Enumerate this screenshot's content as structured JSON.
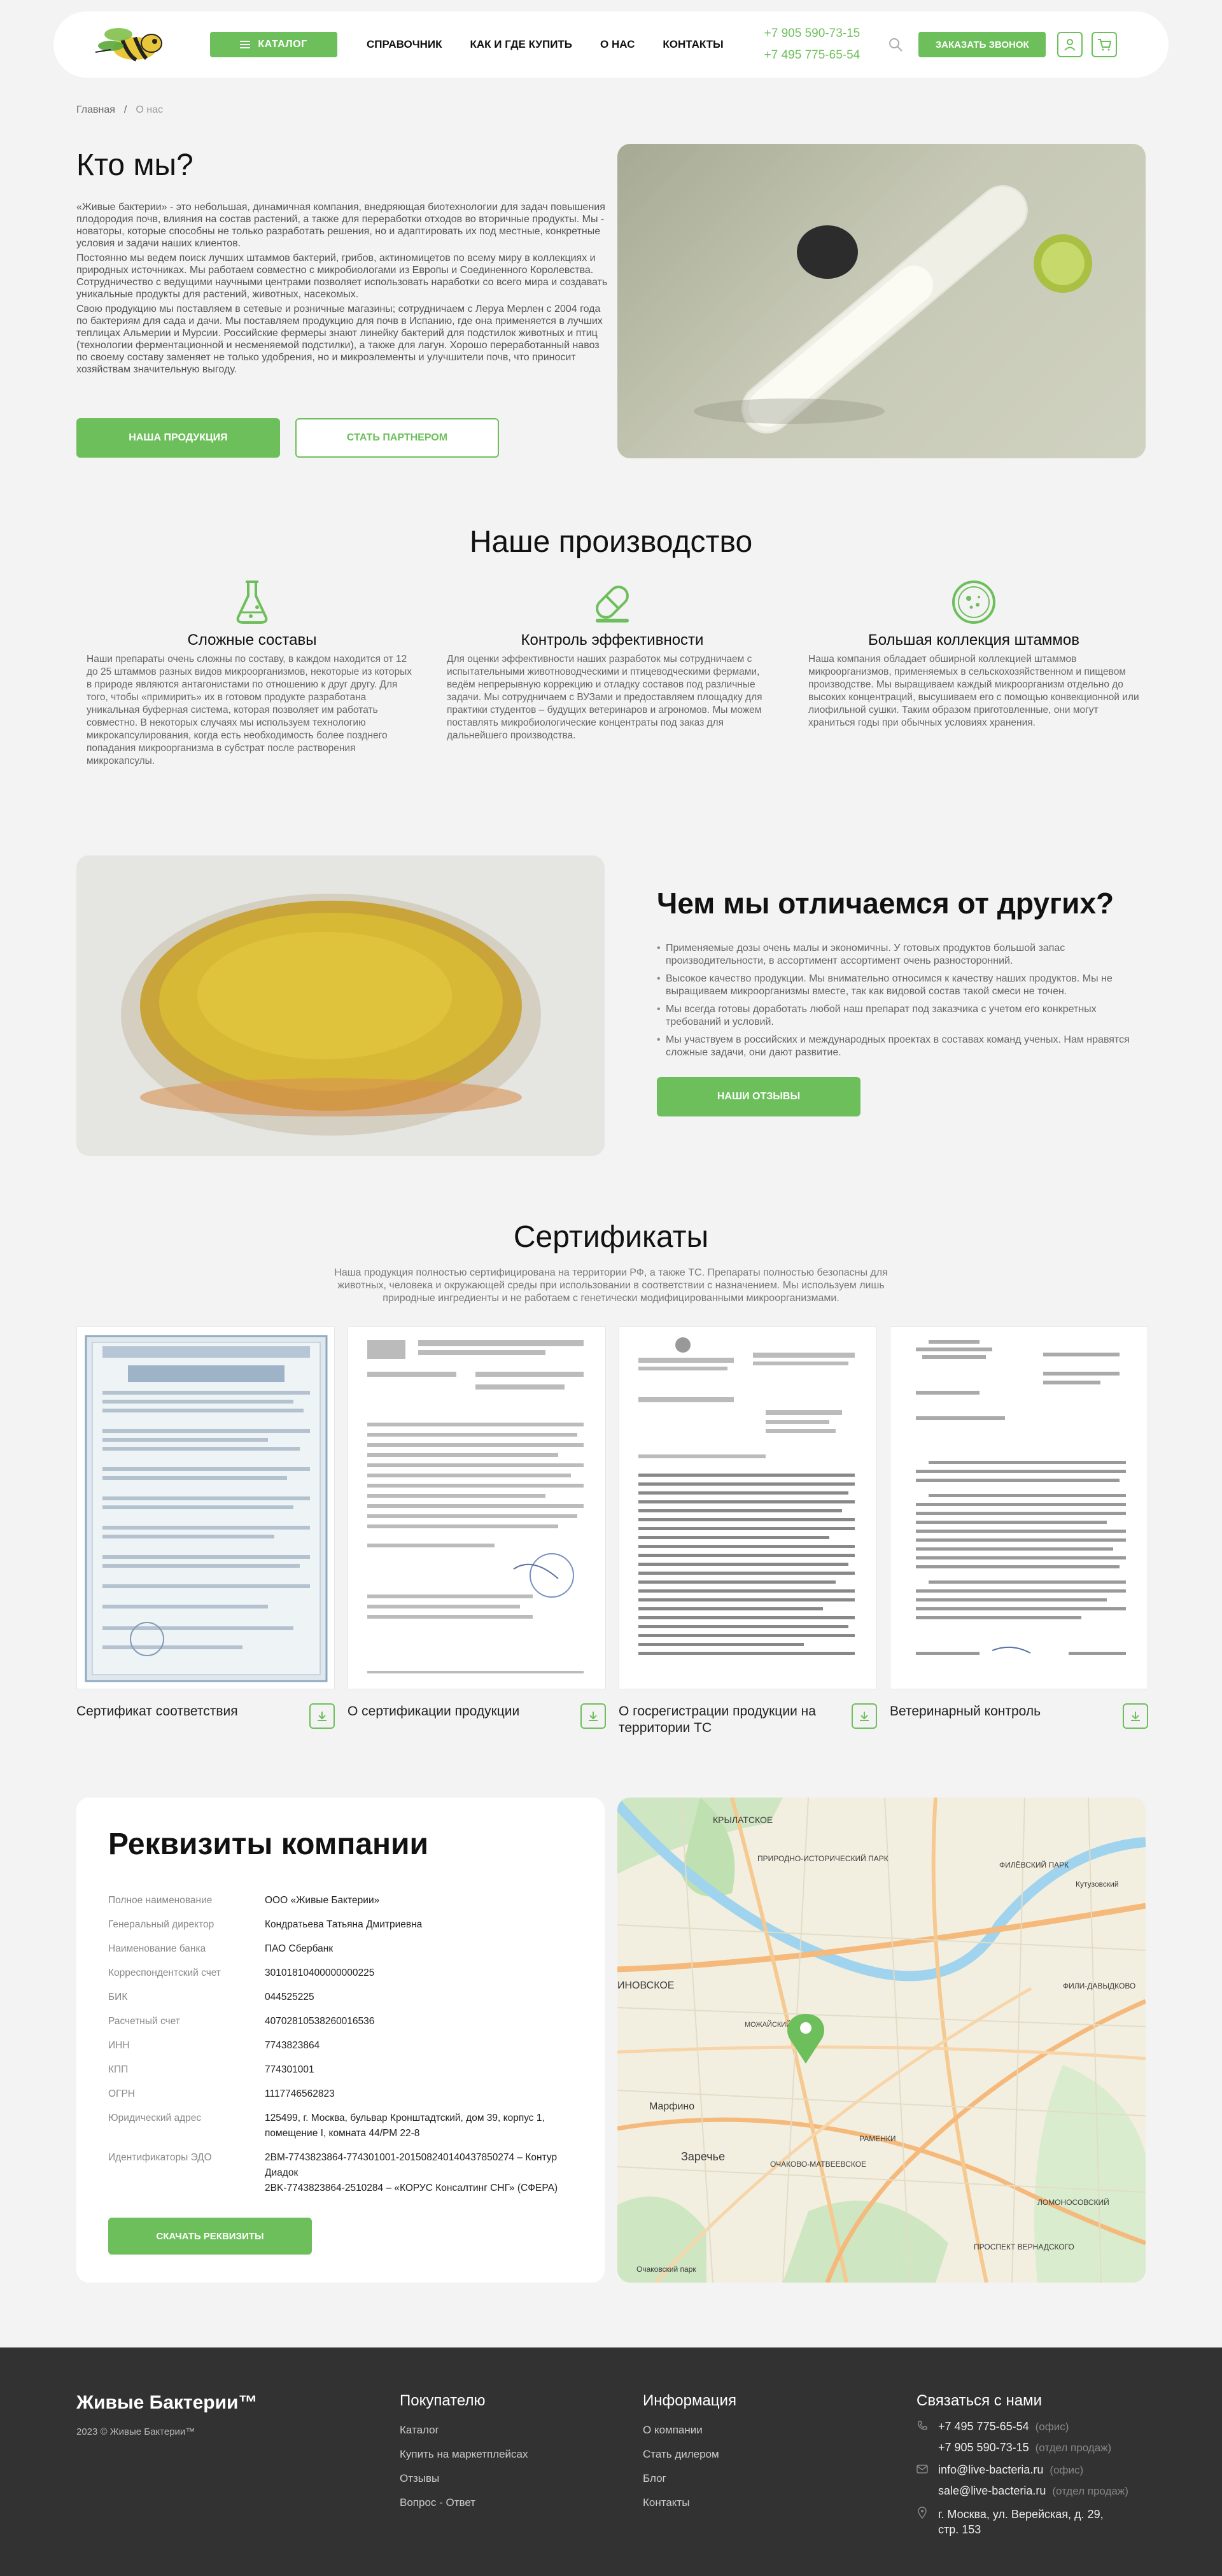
{
  "header": {
    "catalog_label": "КАТАЛОГ",
    "nav": [
      "СПРАВОЧНИК",
      "КАК И ГДЕ КУПИТЬ",
      "О НАС",
      "КОНТАКТЫ"
    ],
    "phones": [
      "+7 905 590-73-15",
      "+7 495 775-65-54"
    ],
    "call_label": "ЗАКАЗАТЬ ЗВОНОК"
  },
  "breadcrumb": {
    "home": "Главная",
    "sep": "/",
    "current": "О нас"
  },
  "about": {
    "title": "Кто мы?",
    "paragraphs": [
      "«Живые бактерии» - это небольшая, динамичная компания, внедряющая биотехнологии для задач повышения плодородия почв, влияния на состав растений, а также для переработки отходов во вторичные продукты. Мы - новаторы, которые способны не только разработать решения, но и адаптировать их под местные, конкретные условия и задачи наших клиентов.",
      "Постоянно мы ведем поиск лучших штаммов бактерий, грибов, актиномицетов по всему миру в коллекциях и природных источниках. Мы работаем совместно с микробиологами из Европы и Соединенного Королевства. Сотрудничество с ведущими научными центрами позволяет использовать наработки со всего мира и создавать уникальные продукты для растений, животных, насекомых.",
      "Свою продукцию мы поставляем в сетевые и розничные магазины; сотрудничаем с Леруа Мерлен с 2004 года по бактериям для сада и дачи. Мы поставляем продукцию для почв в Испанию, где она применяется в лучших теплицах Альмерии и Мурсии. Российские фермеры знают линейку бактерий для подстилок животных и птиц (технологии ферментационной и несменяемой подстилки), а также для лагун. Хорошо переработанный навоз по своему составу заменяет не только удобрения, но и микроэлементы и улучшители почв, что приносит хозяйствам значительную выгоду."
    ],
    "btn_products": "НАША ПРОДУКЦИЯ",
    "btn_partner": "СТАТЬ ПАРТНЕРОМ"
  },
  "production": {
    "title": "Наше производство",
    "features": [
      {
        "title": "Сложные составы",
        "text": "Наши препараты очень сложны по составу, в каждом находится от 12 до 25 штаммов разных видов микроорганизмов, некоторые из которых в природе являются антагонистами по отношению к друг другу. Для того, чтобы «примирить» их в готовом продукте разработана уникальная буферная система, которая позволяет им работать совместно. В некоторых случаях мы используем технологию микрокапсулирования, когда есть необходимость более позднего попадания микроорганизма в субстрат после растворения микрокапсулы."
      },
      {
        "title": "Контроль эффективности",
        "text": "Для оценки эффективности наших разработок мы сотрудничаем с испытательными животноводческими и птицеводческими фермами, ведём непрерывную коррекцию и отладку составов под различные задачи. Мы сотрудничаем с ВУЗами и предоставляем площадку для практики студентов – будущих ветеринаров и агрономов. Мы можем поставлять микробиологические концентраты под заказ для дальнейшего производства."
      },
      {
        "title": "Большая коллекция штаммов",
        "text": "Наша компания обладает обширной коллекцией штаммов микроорганизмов, применяемых в сельскохозяйственном и пищевом производстве. Мы выращиваем каждый микроорганизм отдельно до высоких концентраций, высушиваем его с помощью конвекционной или лиофильной сушки. Таким образом приготовленные, они могут храниться годы при обычных условиях хранения."
      }
    ]
  },
  "differences": {
    "title": "Чем мы отличаемся от других?",
    "items": [
      "Применяемые дозы очень малы и экономичны. У готовых продуктов большой запас производительности, в ассортимент ассортимент очень разносторонний.",
      "Высокое качество продукции. Мы внимательно относимся к качеству наших продуктов. Мы не выращиваем микроорганизмы вместе, так как видовой состав такой смеси не точен.",
      "Мы всегда готовы доработать любой наш препарат под заказчика с учетом его конкретных требований и условий.",
      "Мы участвуем в российских и международных проектах в составах команд ученых. Нам нравятся сложные задачи, они дают развитие."
    ],
    "btn": "НАШИ ОТЗЫВЫ"
  },
  "certificates": {
    "title": "Сертификаты",
    "subtitle": "Наша продукция полностью сертифицирована на территории РФ, а также ТС. Препараты полностью безопасны для животных, человека и окружающей среды при использовании в соответствии с назначением. Мы используем лишь природные ингредиенты и не работаем с генетически модифицированными микроорганизмами.",
    "items": [
      {
        "caption": "Сертификат соответствия"
      },
      {
        "caption": "О сертификации продукции"
      },
      {
        "caption": "О госрегистрации продукции на территории ТС"
      },
      {
        "caption": "Ветеринарный контроль"
      }
    ]
  },
  "requisites": {
    "title": "Реквизиты компании",
    "rows": [
      {
        "k": "Полное наименование",
        "v": "ООО «Живые Бактерии»"
      },
      {
        "k": "Генеральный директор",
        "v": "Кондратьева Татьяна Дмитриевна"
      },
      {
        "k": "Наименование банка",
        "v": "ПАО Сбербанк"
      },
      {
        "k": "Корреспондентский счет",
        "v": "30101810400000000225"
      },
      {
        "k": "БИК",
        "v": "044525225"
      },
      {
        "k": "Расчетный счет",
        "v": "40702810538260016536"
      },
      {
        "k": "ИНН",
        "v": "7743823864"
      },
      {
        "k": "КПП",
        "v": "774301001"
      },
      {
        "k": "ОГРН",
        "v": "1117746562823"
      },
      {
        "k": "Юридический адрес",
        "v": "125499, г. Москва, бульвар Кронштадтский, дом 39, корпус 1, помещение I, комната 44/РМ 22-8"
      },
      {
        "k": "Идентификаторы ЭДО",
        "v": "2BM-7743823864-774301001-201508240140437850274 – Контур Диадок\n2BK-7743823864-2510284 – «КОРУС Консалтинг СНГ» (СФЕРА)"
      }
    ],
    "btn": "СКАЧАТЬ РЕКВИЗИТЫ"
  },
  "map": {
    "labels": [
      "КРЫЛАТСКОЕ",
      "ПРИРОДНО-ИСТОРИЧЕСКИЙ ПАРК",
      "ФИЛЁВСКИЙ ПАРК",
      "ФИЛИ-ДАВЫДКОВО",
      "Кутузовский",
      "ОЧАКОВО-МАТВЕЕВСКОЕ",
      "Марфино",
      "Заречье",
      "ИНОВСКОЕ",
      "МОЖАЙСКИЙ",
      "ПРОСПЕКТ ВЕРНАДСКОГО",
      "ЛОМОНОСОВСКИЙ",
      "Очаковский парк",
      "РАМЕНКИ"
    ]
  },
  "footer": {
    "brand": "Живые Бактерии™",
    "copy": "2023 © Живые Бактерии™",
    "buyer_title": "Покупателю",
    "buyer_links": [
      "Каталог",
      "Купить на маркетплейсах",
      "Отзывы",
      "Вопрос - Ответ"
    ],
    "info_title": "Информация",
    "info_links": [
      "О компании",
      "Стать дилером",
      "Блог",
      "Контакты"
    ],
    "contact_title": "Связаться с нами",
    "phones": [
      {
        "v": "+7 495 775-65-54",
        "n": "(офис)"
      },
      {
        "v": "+7 905 590-73-15",
        "n": "(отдел продаж)"
      }
    ],
    "emails": [
      {
        "v": "info@live-bacteria.ru",
        "n": "(офис)"
      },
      {
        "v": "sale@live-bacteria.ru",
        "n": "(отдел продаж)"
      }
    ],
    "address": "г. Москва, ул. Верейская, д. 29, стр. 153"
  },
  "colors": {
    "accent": "#6cbf5a",
    "footer_bg": "#323232",
    "page_bg": "#f3f3f3"
  }
}
